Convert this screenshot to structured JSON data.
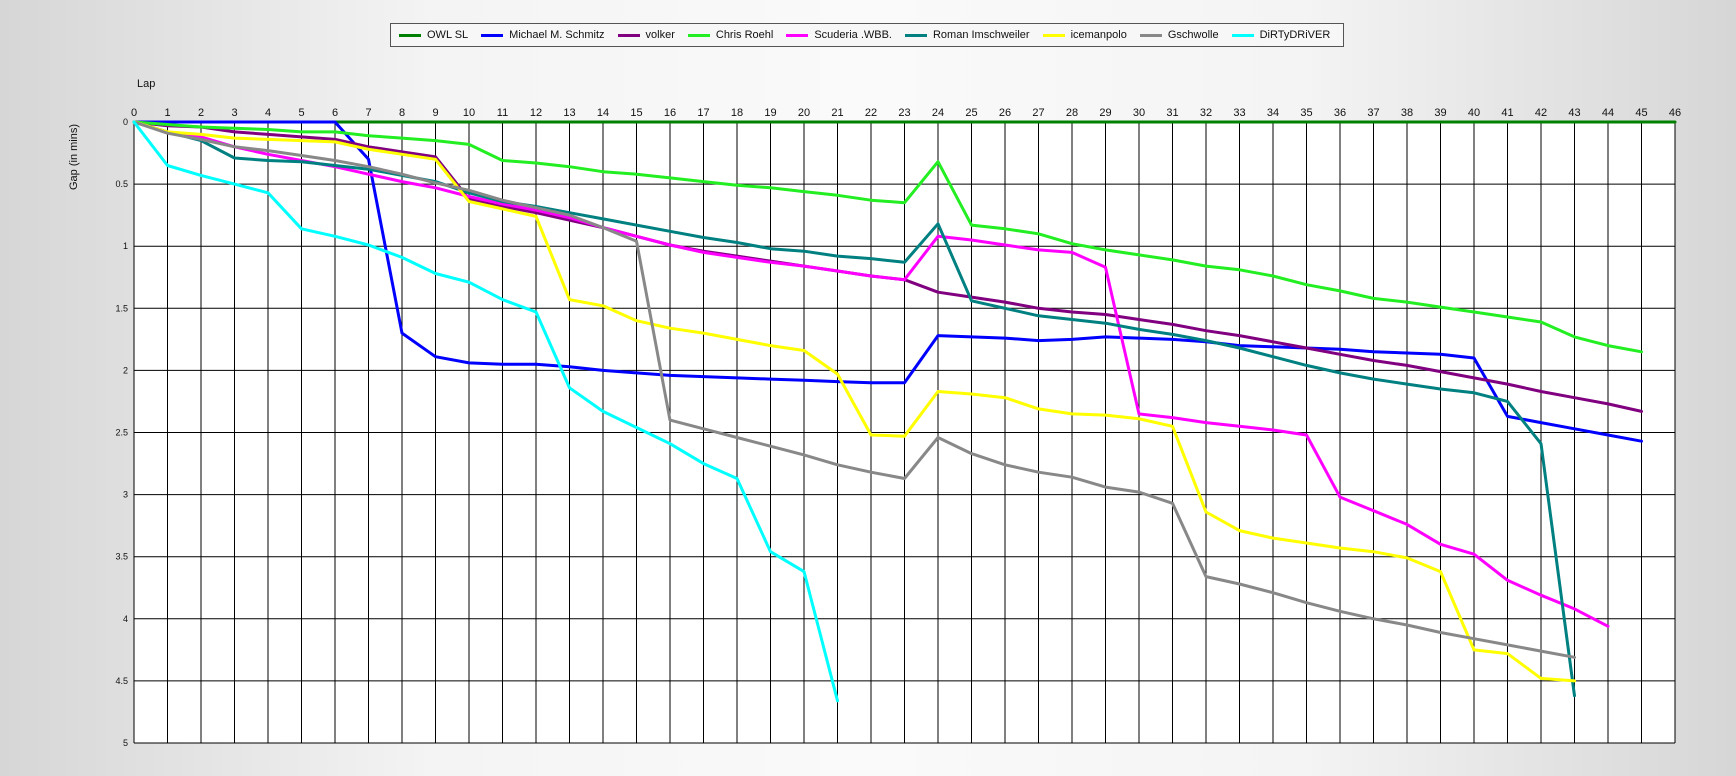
{
  "chart_data": {
    "type": "line",
    "xlabel": "Lap",
    "ylabel": "Gap (in mins)",
    "xlim": [
      0,
      46
    ],
    "ylim": [
      0,
      5
    ],
    "y_inverted": true,
    "x_ticks": [
      0,
      1,
      2,
      3,
      4,
      5,
      6,
      7,
      8,
      9,
      10,
      11,
      12,
      13,
      14,
      15,
      16,
      17,
      18,
      19,
      20,
      21,
      22,
      23,
      24,
      25,
      26,
      27,
      28,
      29,
      30,
      31,
      32,
      33,
      34,
      35,
      36,
      37,
      38,
      39,
      40,
      41,
      42,
      43,
      44,
      45,
      46
    ],
    "y_ticks": [
      {
        "value": 0,
        "label": "0"
      },
      {
        "value": 0.5,
        "label": "0.5"
      },
      {
        "value": 1,
        "label": "1"
      },
      {
        "value": 1.5,
        "label": "1.5"
      },
      {
        "value": 2,
        "label": "2"
      },
      {
        "value": 2.5,
        "label": "2.5"
      },
      {
        "value": 3,
        "label": "3"
      },
      {
        "value": 3.5,
        "label": "3.5"
      },
      {
        "value": 4,
        "label": "4"
      },
      {
        "value": 4.5,
        "label": "4.5"
      },
      {
        "value": 5,
        "label": "5"
      }
    ],
    "grid": true,
    "legend_position": "top",
    "series": [
      {
        "name": "OWL SL",
        "color": "#008000",
        "x_start": 0,
        "values": [
          0,
          0,
          0,
          0,
          0,
          0,
          0,
          0,
          0,
          0,
          0,
          0,
          0,
          0,
          0,
          0,
          0,
          0,
          0,
          0,
          0,
          0,
          0,
          0,
          0,
          0,
          0,
          0,
          0,
          0,
          0,
          0,
          0,
          0,
          0,
          0,
          0,
          0,
          0,
          0,
          0,
          0,
          0,
          0,
          0,
          0,
          0
        ]
      },
      {
        "name": "Michael M. Schmitz",
        "color": "#0000ff",
        "x_start": 0,
        "values": [
          0,
          0,
          0,
          0,
          0,
          0,
          0,
          0.3,
          1.7,
          1.89,
          1.94,
          1.95,
          1.95,
          1.97,
          2.0,
          2.02,
          2.04,
          2.05,
          2.06,
          2.07,
          2.08,
          2.09,
          2.1,
          2.1,
          1.72,
          1.73,
          1.74,
          1.76,
          1.75,
          1.73,
          1.74,
          1.75,
          1.77,
          1.8,
          1.81,
          1.82,
          1.83,
          1.85,
          1.86,
          1.87,
          1.9,
          2.37,
          2.42,
          2.47,
          2.52,
          2.57
        ]
      },
      {
        "name": "volker",
        "color": "#800080",
        "x_start": 0,
        "values": [
          0,
          0.03,
          0.04,
          0.08,
          0.1,
          0.12,
          0.14,
          0.2,
          0.24,
          0.28,
          0.62,
          0.68,
          0.73,
          0.79,
          0.85,
          0.92,
          0.99,
          1.04,
          1.08,
          1.12,
          1.16,
          1.2,
          1.24,
          1.27,
          1.37,
          1.41,
          1.45,
          1.5,
          1.53,
          1.55,
          1.59,
          1.63,
          1.68,
          1.72,
          1.77,
          1.82,
          1.87,
          1.92,
          1.96,
          2.01,
          2.06,
          2.11,
          2.17,
          2.22,
          2.27,
          2.33
        ]
      },
      {
        "name": "Chris Roehl",
        "color": "#22ee22",
        "x_start": 0,
        "values": [
          0,
          0.02,
          0.04,
          0.05,
          0.06,
          0.08,
          0.08,
          0.11,
          0.13,
          0.15,
          0.18,
          0.31,
          0.33,
          0.36,
          0.4,
          0.42,
          0.45,
          0.48,
          0.51,
          0.53,
          0.56,
          0.59,
          0.63,
          0.65,
          0.32,
          0.83,
          0.86,
          0.9,
          0.98,
          1.03,
          1.07,
          1.11,
          1.16,
          1.19,
          1.24,
          1.31,
          1.36,
          1.42,
          1.45,
          1.49,
          1.53,
          1.57,
          1.61,
          1.73,
          1.8,
          1.85
        ]
      },
      {
        "name": "Scuderia .WBB.",
        "color": "#ff00ff",
        "x_start": 0,
        "values": [
          0,
          0.08,
          0.12,
          0.2,
          0.26,
          0.31,
          0.36,
          0.42,
          0.48,
          0.53,
          0.6,
          0.66,
          0.71,
          0.77,
          0.85,
          0.92,
          0.99,
          1.05,
          1.09,
          1.13,
          1.16,
          1.2,
          1.24,
          1.27,
          0.92,
          0.95,
          0.99,
          1.03,
          1.05,
          1.17,
          2.35,
          2.38,
          2.42,
          2.45,
          2.48,
          2.52,
          3.02,
          3.13,
          3.24,
          3.4,
          3.48,
          3.69,
          3.81,
          3.92,
          4.06
        ]
      },
      {
        "name": "Roman Imschweiler",
        "color": "#008080",
        "x_start": 0,
        "values": [
          0,
          0.08,
          0.15,
          0.29,
          0.31,
          0.32,
          0.35,
          0.38,
          0.43,
          0.48,
          0.57,
          0.64,
          0.68,
          0.73,
          0.78,
          0.83,
          0.88,
          0.93,
          0.97,
          1.02,
          1.04,
          1.08,
          1.1,
          1.13,
          0.82,
          1.44,
          1.5,
          1.56,
          1.59,
          1.62,
          1.67,
          1.71,
          1.76,
          1.82,
          1.89,
          1.96,
          2.02,
          2.07,
          2.11,
          2.15,
          2.18,
          2.25,
          2.59,
          4.62
        ]
      },
      {
        "name": "icemanpolo",
        "color": "#ffff00",
        "x_start": 0,
        "values": [
          0,
          0.08,
          0.1,
          0.13,
          0.14,
          0.15,
          0.16,
          0.22,
          0.26,
          0.3,
          0.64,
          0.7,
          0.76,
          1.43,
          1.48,
          1.6,
          1.66,
          1.7,
          1.75,
          1.8,
          1.84,
          2.03,
          2.52,
          2.53,
          2.17,
          2.19,
          2.22,
          2.31,
          2.35,
          2.36,
          2.39,
          2.45,
          3.14,
          3.29,
          3.35,
          3.39,
          3.43,
          3.46,
          3.51,
          3.62,
          4.25,
          4.28,
          4.48,
          4.5
        ]
      },
      {
        "name": "Gschwolle",
        "color": "#888888",
        "x_start": 0,
        "values": [
          0,
          0.09,
          0.14,
          0.2,
          0.23,
          0.27,
          0.31,
          0.36,
          0.42,
          0.49,
          0.55,
          0.63,
          0.69,
          0.75,
          0.85,
          0.96,
          2.4,
          2.47,
          2.54,
          2.61,
          2.68,
          2.76,
          2.82,
          2.87,
          2.54,
          2.67,
          2.76,
          2.82,
          2.86,
          2.94,
          2.98,
          3.07,
          3.66,
          3.72,
          3.79,
          3.87,
          3.94,
          4.0,
          4.05,
          4.11,
          4.16,
          4.21,
          4.26,
          4.31
        ]
      },
      {
        "name": "DiRTyDRiVER",
        "color": "#00ffff",
        "x_start": 0,
        "values": [
          0,
          0.35,
          0.43,
          0.5,
          0.57,
          0.86,
          0.92,
          0.99,
          1.09,
          1.22,
          1.29,
          1.43,
          1.53,
          2.14,
          2.33,
          2.46,
          2.59,
          2.75,
          2.87,
          3.46,
          3.62,
          4.66
        ]
      }
    ]
  }
}
